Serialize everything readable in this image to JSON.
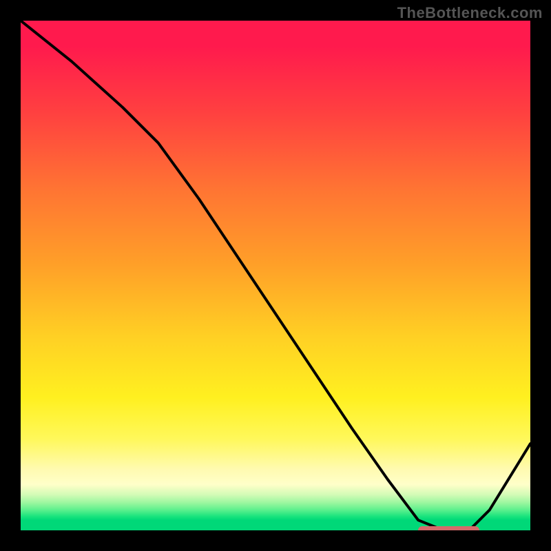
{
  "watermark": "TheBottleneck.com",
  "colors": {
    "bg": "#000000",
    "curve": "#000000",
    "optimum_bar": "#d46a6a"
  },
  "chart_data": {
    "type": "line",
    "title": "",
    "xlabel": "",
    "ylabel": "",
    "xlim": [
      0,
      100
    ],
    "ylim": [
      0,
      100
    ],
    "grid": false,
    "series": [
      {
        "name": "bottleneck-curve",
        "x": [
          0,
          10,
          20,
          27,
          35,
          45,
          55,
          65,
          72,
          78,
          83,
          88,
          92,
          100
        ],
        "y": [
          100,
          92,
          83,
          76,
          65,
          50,
          35,
          20,
          10,
          2,
          0,
          0,
          4,
          17
        ]
      }
    ],
    "optimum_range": {
      "x_start": 78,
      "x_end": 90,
      "y": 0
    },
    "gradient_stops": [
      {
        "pct": 0,
        "color": "#ff1a4d"
      },
      {
        "pct": 18,
        "color": "#ff4040"
      },
      {
        "pct": 48,
        "color": "#ffa028"
      },
      {
        "pct": 74,
        "color": "#fff020"
      },
      {
        "pct": 91,
        "color": "#ffffc9"
      },
      {
        "pct": 98,
        "color": "#00d878"
      }
    ]
  }
}
